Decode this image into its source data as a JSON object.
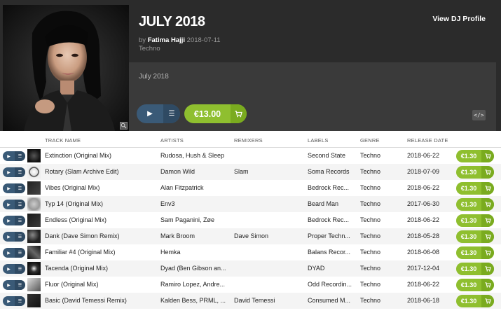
{
  "release": {
    "title": "JULY 2018",
    "by_prefix": "by",
    "author": "Fatima Hajji",
    "date": "2018-07-11",
    "genre": "Techno",
    "description": "July 2018",
    "price": "€13.00",
    "view_dj_label": "View DJ Profile",
    "embed_label": "</>"
  },
  "colors": {
    "header_bg": "#2b2b2b",
    "accent_green": "#8fbf2f",
    "play_blue": "#3a5a77"
  },
  "icons": {
    "play": "play-icon",
    "queue": "queue-icon",
    "cart": "cart-icon",
    "zoom": "zoom-icon",
    "embed": "embed-icon"
  },
  "columns": [
    "TRACK NAME",
    "ARTISTS",
    "REMIXERS",
    "LABELS",
    "GENRE",
    "RELEASE DATE"
  ],
  "tracks": [
    {
      "name": "Extinction (Original Mix)",
      "artists": "Rudosa, Hush & Sleep",
      "remixers": "",
      "label": "Second State",
      "genre": "Techno",
      "date": "2018-06-22",
      "price": "€1.30"
    },
    {
      "name": "Rotary (Slam Archive Edit)",
      "artists": "Damon Wild",
      "remixers": "Slam",
      "label": "Soma Records",
      "genre": "Techno",
      "date": "2018-07-09",
      "price": "€1.30"
    },
    {
      "name": "Vibes (Original Mix)",
      "artists": "Alan Fitzpatrick",
      "remixers": "",
      "label": "Bedrock Rec...",
      "genre": "Techno",
      "date": "2018-06-22",
      "price": "€1.30"
    },
    {
      "name": "Typ 14 (Original Mix)",
      "artists": "Env3",
      "remixers": "",
      "label": "Beard Man",
      "genre": "Techno",
      "date": "2017-06-30",
      "price": "€1.30"
    },
    {
      "name": "Endless (Original Mix)",
      "artists": "Sam Paganini, Zøe",
      "remixers": "",
      "label": "Bedrock Rec...",
      "genre": "Techno",
      "date": "2018-06-22",
      "price": "€1.30"
    },
    {
      "name": "Dank (Dave Simon Remix)",
      "artists": "Mark Broom",
      "remixers": "Dave Simon",
      "label": "Proper Techn...",
      "genre": "Techno",
      "date": "2018-05-28",
      "price": "€1.30"
    },
    {
      "name": "Familiar #4 (Original Mix)",
      "artists": "Hemka",
      "remixers": "",
      "label": "Balans Recor...",
      "genre": "Techno",
      "date": "2018-06-08",
      "price": "€1.30"
    },
    {
      "name": "Tacenda (Original Mix)",
      "artists": "Dyad (Ben Gibson an...",
      "remixers": "",
      "label": "DYAD",
      "genre": "Techno",
      "date": "2017-12-04",
      "price": "€1.30"
    },
    {
      "name": "Fluor (Original Mix)",
      "artists": "Ramiro Lopez, Andre...",
      "remixers": "",
      "label": "Odd Recordin...",
      "genre": "Techno",
      "date": "2018-06-22",
      "price": "€1.30"
    },
    {
      "name": "Basic (David Temessi Remix)",
      "artists": "Kalden Bess, PRML, ...",
      "remixers": "David Temessi",
      "label": "Consumed M...",
      "genre": "Techno",
      "date": "2018-06-18",
      "price": "€1.30"
    }
  ]
}
